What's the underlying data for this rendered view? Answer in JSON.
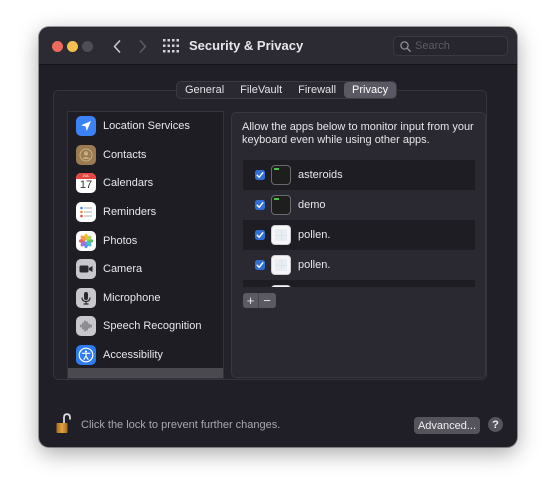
{
  "window": {
    "title": "Security & Privacy",
    "search_placeholder": "Search",
    "search_value": ""
  },
  "tabs": [
    {
      "label": "General",
      "active": false
    },
    {
      "label": "FileVault",
      "active": false
    },
    {
      "label": "Firewall",
      "active": false
    },
    {
      "label": "Privacy",
      "active": true
    }
  ],
  "sidebar": {
    "items": [
      {
        "label": "Location Services",
        "icon": "location-arrow-icon"
      },
      {
        "label": "Contacts",
        "icon": "contacts-icon"
      },
      {
        "label": "Calendars",
        "icon": "calendar-icon",
        "calendar_month": "JUL",
        "calendar_day": "17"
      },
      {
        "label": "Reminders",
        "icon": "reminders-icon"
      },
      {
        "label": "Photos",
        "icon": "photos-icon"
      },
      {
        "label": "Camera",
        "icon": "camera-icon"
      },
      {
        "label": "Microphone",
        "icon": "microphone-icon"
      },
      {
        "label": "Speech Recognition",
        "icon": "speech-waveform-icon"
      },
      {
        "label": "Accessibility",
        "icon": "accessibility-icon"
      }
    ]
  },
  "panel": {
    "description": "Allow the apps below to monitor input from your keyboard even while using other apps.",
    "apps": [
      {
        "name": "asteroids",
        "checked": true,
        "icon": "terminal-icon"
      },
      {
        "name": "demo",
        "checked": true,
        "icon": "terminal-icon"
      },
      {
        "name": "pollen.",
        "checked": true,
        "icon": "pollen-app-icon"
      },
      {
        "name": "pollen.",
        "checked": true,
        "icon": "pollen-app-icon"
      }
    ],
    "add_label": "+",
    "remove_label": "−"
  },
  "footer": {
    "lock_text": "Click the lock to prevent further changes.",
    "advanced_label": "Advanced...",
    "help_label": "?"
  },
  "colors": {
    "traffic_red": "#ec6a5e",
    "traffic_yellow": "#f4bf4f",
    "checkbox_accent": "#2f6fd6",
    "window_bg": "#201e27"
  }
}
